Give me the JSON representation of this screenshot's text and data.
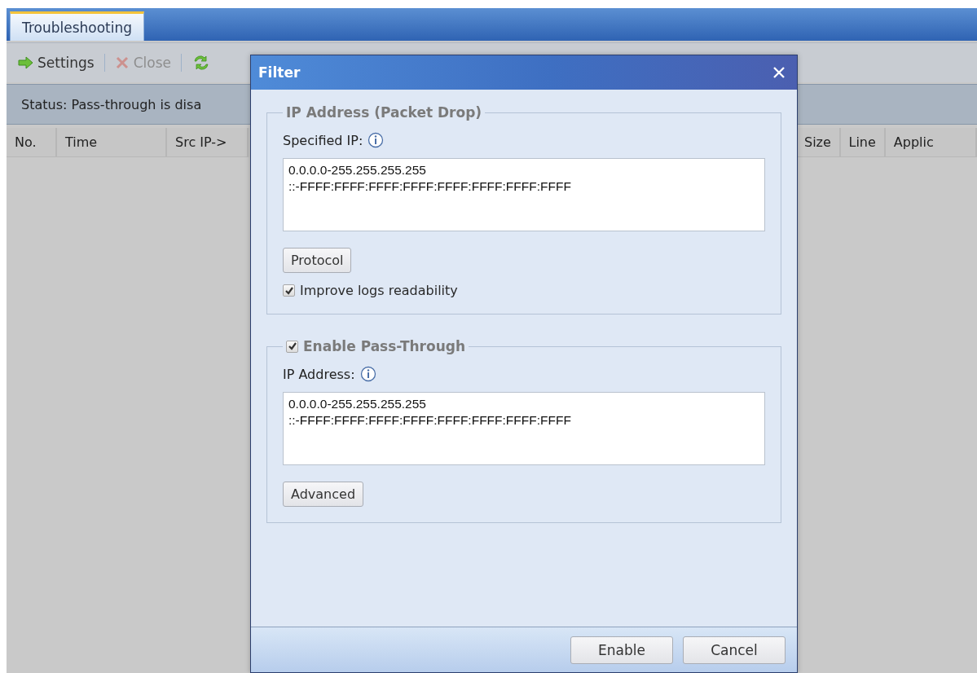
{
  "tabs": [
    {
      "label": "Troubleshooting",
      "selected": true
    }
  ],
  "toolbar": [
    {
      "kind": "arrow",
      "label": "Settings",
      "disabled": false
    },
    {
      "kind": "close",
      "label": "Close",
      "disabled": true
    },
    {
      "kind": "refresh",
      "disabled": false
    }
  ],
  "status": "Status: Pass-through is disa",
  "table": {
    "columns": [
      "No.",
      "Time",
      "Src IP->",
      "Size",
      "Line",
      "Applic"
    ]
  },
  "dialog": {
    "title": "Filter",
    "sections": [
      {
        "legend": "IP Address (Packet Drop)",
        "field_label": "Specified IP:",
        "lines": [
          "0.0.0.0-255.255.255.255",
          "::-FFFF:FFFF:FFFF:FFFF:FFFF:FFFF:FFFF:FFFF"
        ],
        "button": "Protocol",
        "checkbox": {
          "label": "Improve logs readability",
          "checked": true
        }
      },
      {
        "legend": "Enable Pass-Through",
        "legend_checked": true,
        "field_label": "IP Address:",
        "lines": [
          "0.0.0.0-255.255.255.255",
          "::-FFFF:FFFF:FFFF:FFFF:FFFF:FFFF:FFFF:FFFF"
        ],
        "button": "Advanced"
      }
    ],
    "buttons": [
      "Enable",
      "Cancel"
    ]
  }
}
